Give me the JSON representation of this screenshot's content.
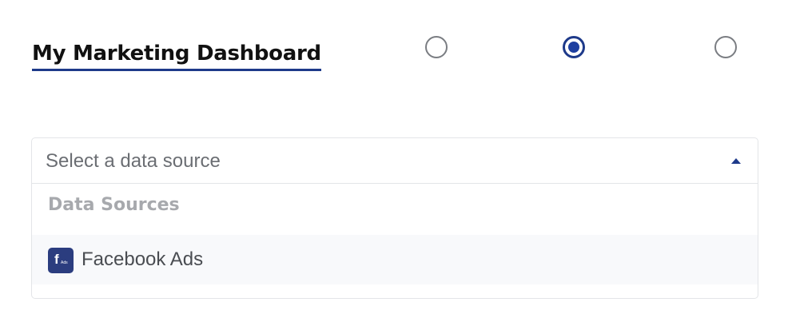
{
  "header": {
    "title": "My Marketing Dashboard"
  },
  "radios": [
    {
      "selected": false
    },
    {
      "selected": true
    },
    {
      "selected": false
    }
  ],
  "data_source_select": {
    "placeholder": "Select a data source",
    "group_label": "Data Sources",
    "options": [
      {
        "label": "Facebook Ads",
        "icon": "facebook-ads-logo-icon",
        "logo_text": "f",
        "logo_subtext": "Ads"
      }
    ]
  },
  "colors": {
    "accent": "#1e3a8a",
    "radio_border": "#7a7d82",
    "placeholder_text": "#6b6e73",
    "group_label_text": "#a7a9ad",
    "option_hover_bg": "#f8f9fb",
    "logo_bg": "#2b3d7f"
  }
}
